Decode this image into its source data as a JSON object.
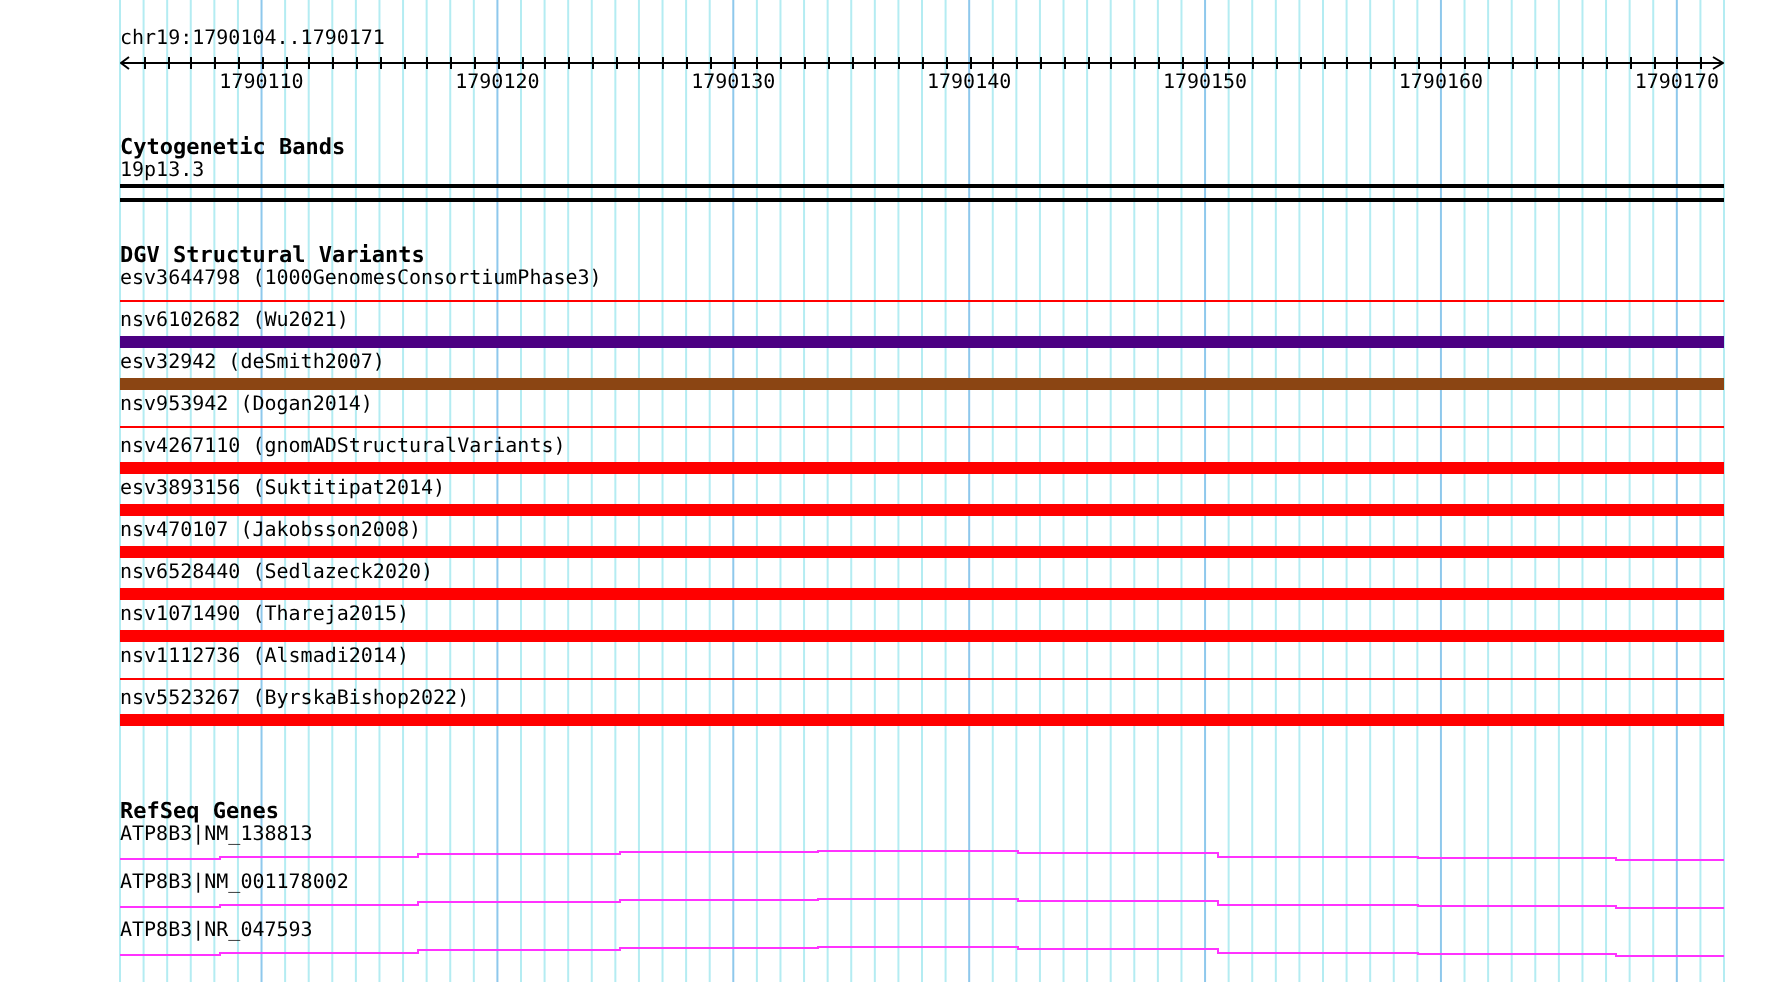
{
  "ruler": {
    "position": "chr19:1790104..1790171",
    "ticks": [
      "1790110",
      "1790120",
      "1790130",
      "1790140",
      "1790150",
      "1790160",
      "1790170"
    ]
  },
  "cytobands": {
    "title": "Cytogenetic Bands",
    "bands": [
      {
        "label": "19p13.3"
      }
    ]
  },
  "dgv": {
    "title": "DGV Structural Variants",
    "variants": [
      {
        "label": "esv3644798 (1000GenomesConsortiumPhase3)",
        "kind": "thin",
        "color": "#ff0000"
      },
      {
        "label": "nsv6102682 (Wu2021)",
        "kind": "thick",
        "color": "#4b0082"
      },
      {
        "label": "esv32942 (deSmith2007)",
        "kind": "thick",
        "color": "#8b4513"
      },
      {
        "label": "nsv953942 (Dogan2014)",
        "kind": "thin",
        "color": "#ff0000"
      },
      {
        "label": "nsv4267110 (gnomADStructuralVariants)",
        "kind": "thick",
        "color": "#ff0000"
      },
      {
        "label": "esv3893156 (Suktitipat2014)",
        "kind": "thick",
        "color": "#ff0000"
      },
      {
        "label": "nsv470107 (Jakobsson2008)",
        "kind": "thick",
        "color": "#ff0000"
      },
      {
        "label": "nsv6528440 (Sedlazeck2020)",
        "kind": "thick",
        "color": "#ff0000"
      },
      {
        "label": "nsv1071490 (Thareja2015)",
        "kind": "thick",
        "color": "#ff0000"
      },
      {
        "label": "nsv1112736 (Alsmadi2014)",
        "kind": "thin",
        "color": "#ff0000"
      },
      {
        "label": "nsv5523267 (ByrskaBishop2022)",
        "kind": "thick",
        "color": "#ff0000"
      }
    ]
  },
  "refseq": {
    "title": "RefSeq Genes",
    "genes": [
      {
        "label": "ATP8B3|NM_138813"
      },
      {
        "label": "ATP8B3|NM_001178002"
      },
      {
        "label": "ATP8B3|NR_047593"
      }
    ]
  }
}
